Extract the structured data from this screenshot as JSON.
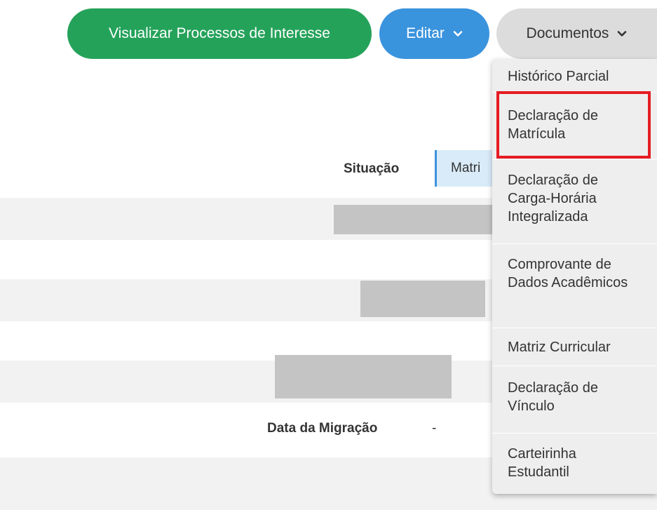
{
  "actions": {
    "visualizar_label": "Visualizar Processos de Interesse",
    "editar_label": "Editar",
    "documentos_label": "Documentos"
  },
  "fields": {
    "situacao_label": "Situação",
    "situacao_tag": "Matri",
    "data_migracao_label": "Data da Migração",
    "data_migracao_value": "-"
  },
  "documentos_menu": {
    "items": [
      {
        "label": "Histórico Parcial",
        "highlighted": false
      },
      {
        "label": "Declaração de Matrícula",
        "highlighted": true
      },
      {
        "label": "Declaração de Carga-Horária Integralizada",
        "highlighted": false
      },
      {
        "label": "Comprovante de Dados Acadêmicos",
        "highlighted": false
      },
      {
        "label": "Matriz Curricular",
        "highlighted": false
      },
      {
        "label": "Declaração de Vínculo",
        "highlighted": false
      },
      {
        "label": "Carteirinha Estudantil",
        "highlighted": false
      }
    ]
  },
  "colors": {
    "green": "#25a25a",
    "blue": "#3a93dd",
    "gray": "#dcdcdc",
    "highlight": "#e51c23"
  },
  "icons": {
    "dropdown": "chevron-down-icon"
  }
}
